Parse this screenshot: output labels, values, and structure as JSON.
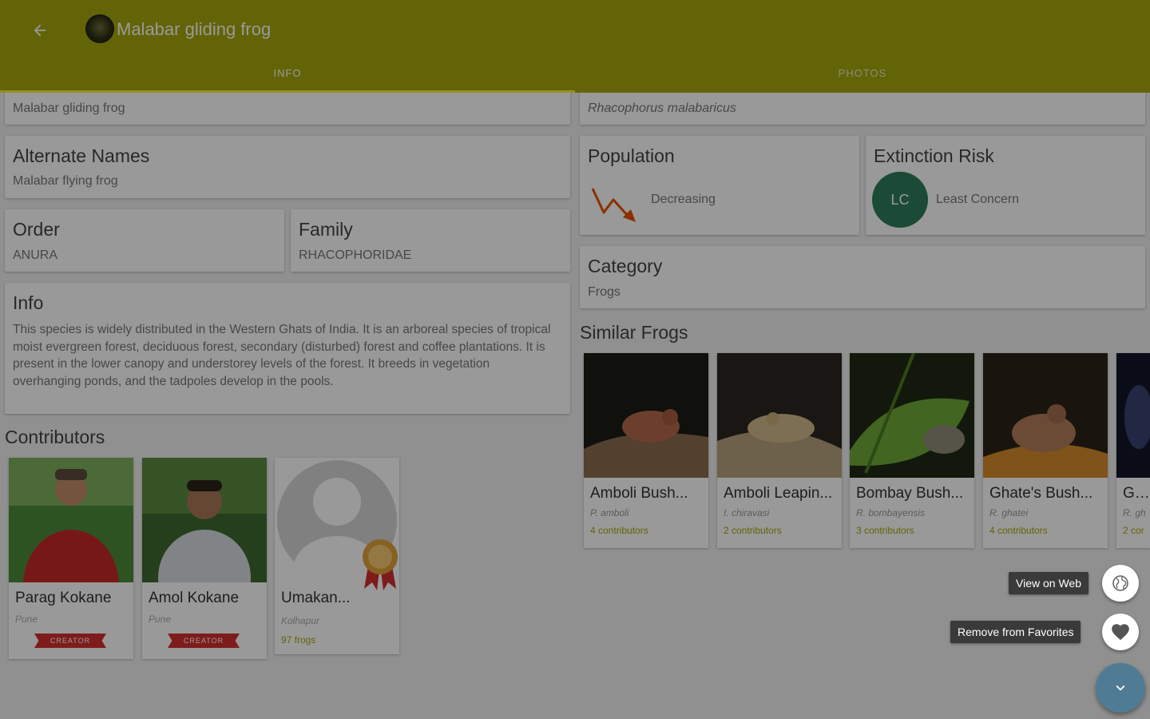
{
  "header": {
    "title": "Malabar gliding frog",
    "tabs": [
      {
        "label": "INFO",
        "active": true
      },
      {
        "label": "PHOTOS",
        "active": false
      }
    ]
  },
  "common_name": "Malabar gliding frog",
  "scientific_name": "Rhacophorus malabaricus",
  "alternate_names": {
    "title": "Alternate Names",
    "value": "Malabar flying frog"
  },
  "order": {
    "title": "Order",
    "value": "ANURA"
  },
  "family": {
    "title": "Family",
    "value": "RHACOPHORIDAE"
  },
  "info": {
    "title": "Info",
    "text": "This species is widely distributed in the Western Ghats of India. It is an arboreal species of tropical moist evergreen forest, deciduous forest, secondary (disturbed) forest and coffee plantations. It is present in the lower canopy and understorey levels of the forest. It breeds in vegetation overhanging ponds, and the tadpoles develop in the pools."
  },
  "population": {
    "title": "Population",
    "value": "Decreasing",
    "icon": "trend-down-icon"
  },
  "extinction_risk": {
    "title": "Extinction Risk",
    "badge": "LC",
    "value": "Least Concern"
  },
  "category": {
    "title": "Category",
    "value": "Frogs"
  },
  "contributors": {
    "title": "Contributors",
    "items": [
      {
        "name": "Parag Kokane",
        "location": "Pune",
        "badge": "CREATOR"
      },
      {
        "name": "Amol Kokane",
        "location": "Pune",
        "badge": "CREATOR"
      },
      {
        "name": "Umakan...",
        "location": "Kolhapur",
        "extra": "97 frogs"
      }
    ]
  },
  "similar": {
    "title": "Similar Frogs",
    "items": [
      {
        "name": "Amboli Bush...",
        "sci": "P. amboli",
        "contrib": "4 contributors"
      },
      {
        "name": "Amboli Leapin...",
        "sci": "I. chiravasi",
        "contrib": "2 contributors"
      },
      {
        "name": "Bombay Bush...",
        "sci": "R. bombayensis",
        "contrib": "3 contributors"
      },
      {
        "name": "Ghate's Bush...",
        "sci": "R. ghatei",
        "contrib": "4 contributors"
      },
      {
        "name": "Gha",
        "sci": "R. gh",
        "contrib": "2 cor"
      }
    ]
  },
  "fab": {
    "web_label": "View on Web",
    "favorite_label": "Remove from Favorites"
  },
  "colors": {
    "appbar": "#a6a70d",
    "lc_badge": "#2e7d5b",
    "trend": "#e65100",
    "fab_main": "#4f7c94",
    "creator": "#d32f2f"
  }
}
